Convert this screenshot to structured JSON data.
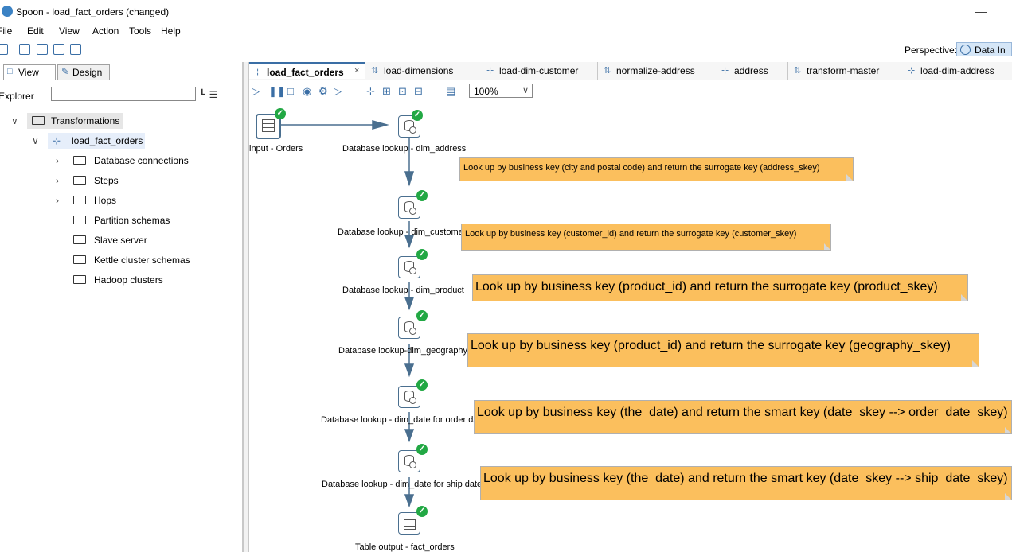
{
  "window": {
    "title": "Spoon - load_fact_orders (changed)"
  },
  "menu": [
    "File",
    "Edit",
    "View",
    "Action",
    "Tools",
    "Help"
  ],
  "perspective": {
    "label": "Perspective:",
    "value": "Data In"
  },
  "left_panel": {
    "tabs": [
      "View",
      "Design"
    ],
    "explorer_label": "Explorer",
    "explorer_value": "",
    "tree": {
      "root": "Transformations",
      "transformation": "load_fact_orders",
      "items": [
        "Database connections",
        "Steps",
        "Hops",
        "Partition schemas",
        "Slave server",
        "Kettle cluster schemas",
        "Hadoop clusters"
      ]
    }
  },
  "tabs": [
    {
      "label": "load_fact_orders",
      "icon": "transformation-icon",
      "active": true
    },
    {
      "label": "load-dimensions",
      "icon": "job-icon"
    },
    {
      "label": "load-dim-customer",
      "icon": "transformation-icon"
    },
    {
      "label": "normalize-address",
      "icon": "job-icon"
    },
    {
      "label": "address",
      "icon": "transformation-icon"
    },
    {
      "label": "transform-master",
      "icon": "job-icon"
    },
    {
      "label": "load-dim-address",
      "icon": "transformation-icon"
    }
  ],
  "zoom": "100%",
  "steps": [
    {
      "label": "input - Orders",
      "type": "table-input"
    },
    {
      "label": "Database lookup - dim_address",
      "type": "database-lookup"
    },
    {
      "label": "Database lookup - dim_customer",
      "type": "database-lookup"
    },
    {
      "label": "Database lookup - dim_product",
      "type": "database-lookup"
    },
    {
      "label": "Database lookup-dim_geography",
      "type": "database-lookup"
    },
    {
      "label": "Database lookup - dim_date for order date",
      "type": "database-lookup"
    },
    {
      "label": "Database lookup - dim_date for ship date",
      "type": "database-lookup"
    },
    {
      "label": "Table output - fact_orders",
      "type": "table-output"
    }
  ],
  "notes": [
    "Look up by business key (city and postal code) and return the surrogate key (address_skey)",
    "Look up by business key (customer_id) and return the surrogate key (customer_skey)",
    "Look up by business key (product_id) and return the surrogate key (product_skey)",
    "Look up by business key (product_id) and return the surrogate key (geography_skey)",
    "Look up by business key (the_date) and return the smart key (date_skey --> order_date_skey)",
    "Look up by business key (the_date) and return the smart key (date_skey --> ship_date_skey)"
  ]
}
